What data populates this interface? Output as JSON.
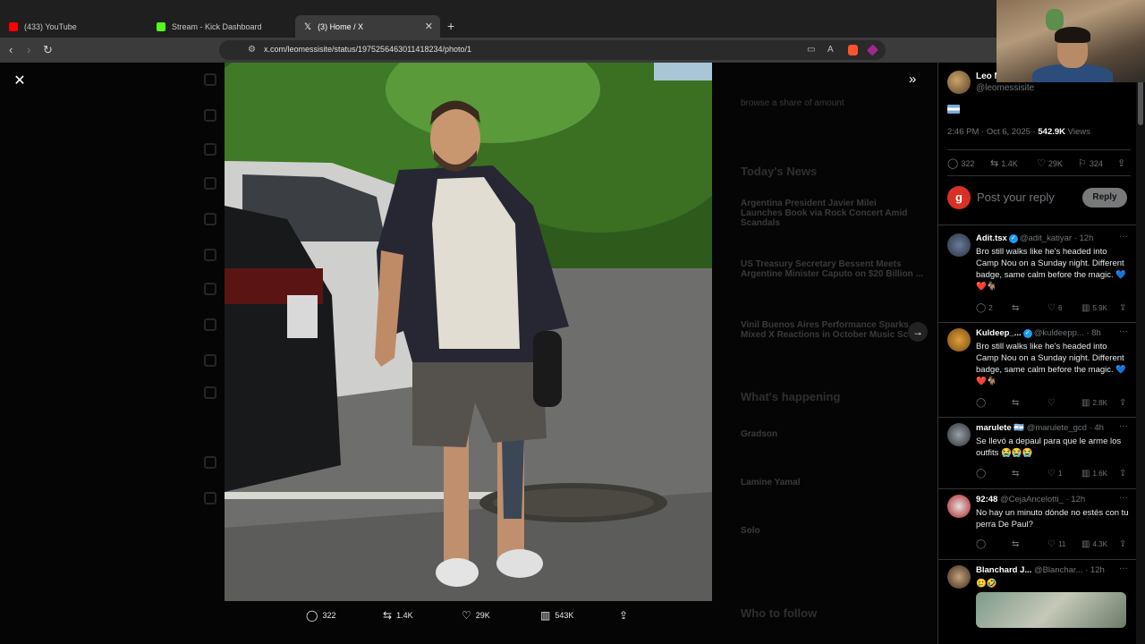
{
  "browser": {
    "tabs": [
      {
        "label": "(433) YouTube",
        "favicon_color": "#ff0000",
        "active": false
      },
      {
        "label": "Stream - Kick Dashboard",
        "favicon_color": "#53fc18",
        "active": false
      },
      {
        "label": "(3) Home / X",
        "favicon_color": "#ffffff",
        "active": true
      }
    ],
    "new_tab": "+",
    "url": "x.com/leomessisite/status/1975256463011418234/photo/1"
  },
  "viewer": {
    "close": "✕",
    "expand": "»",
    "next": "→",
    "actions": {
      "replies": "322",
      "reposts": "1.4K",
      "likes": "29K",
      "views": "543K"
    }
  },
  "background_feed": {
    "items": [
      "browse a share of amount",
      "Today's News",
      "Argentina President Javier Milei Launches Book via Rock Concert Amid Scandals",
      "US Treasury Secretary Bessent Meets Argentine Minister Caputo on $20 Billion ...",
      "Vinil Buenos Aires Performance Sparks Mixed X Reactions in October Music Scene",
      "What's happening",
      "Gradson",
      "Lamine Yamal",
      "Solo",
      "Who to follow"
    ]
  },
  "tweet": {
    "author_name": "Leo M",
    "author_handle": "@leomessisite",
    "time": "2:46 PM · Oct 6, 2025 · ",
    "views_count": "542.9K",
    "views_label": " Views",
    "stats": {
      "replies": "322",
      "reposts": "1.4K",
      "likes": "29K",
      "bookmarks": "324"
    }
  },
  "reply_box": {
    "avatar_letter": "g",
    "placeholder": "Post your reply",
    "button": "Reply"
  },
  "replies": [
    {
      "name": "Adit.tsx",
      "verified": true,
      "handle": "@adit_katiyar · 12h",
      "text": "Bro still walks like he's headed into Camp Nou on a Sunday night. Different badge, same calm before the magic. 💙❤️🐐",
      "replies": "2",
      "likes": "6",
      "views": "5.9K"
    },
    {
      "name": "Kuldeep_...",
      "verified": true,
      "handle": "@kuldeepp... · 8h",
      "text": "Bro still walks like he's headed into Camp Nou on a Sunday night. Different badge, same calm before the magic. 💙❤️🐐",
      "replies": "",
      "likes": "",
      "views": "2.8K"
    },
    {
      "name": "marulete 🇦🇷",
      "verified": false,
      "handle": "@marulete_gcd · 4h",
      "text": "Se llevó a depaul para que le arme los outfits 😭😭😭",
      "replies": "",
      "likes": "1",
      "views": "1.6K"
    },
    {
      "name": "92:48",
      "verified": false,
      "handle": "@CejaAncelotti_ · 12h",
      "text": "No hay un minuto dónde no estés con tu perra De Paul?",
      "replies": "",
      "likes": "11",
      "views": "4.3K"
    },
    {
      "name": "Blanchard J...",
      "verified": false,
      "handle": "@Blanchar... · 12h",
      "text": "🥲🤣",
      "replies": "",
      "likes": "",
      "views": ""
    }
  ],
  "colors": {
    "accent_blue": "#1d9bf0",
    "muted": "#71767b",
    "like_red": "#f91880"
  }
}
